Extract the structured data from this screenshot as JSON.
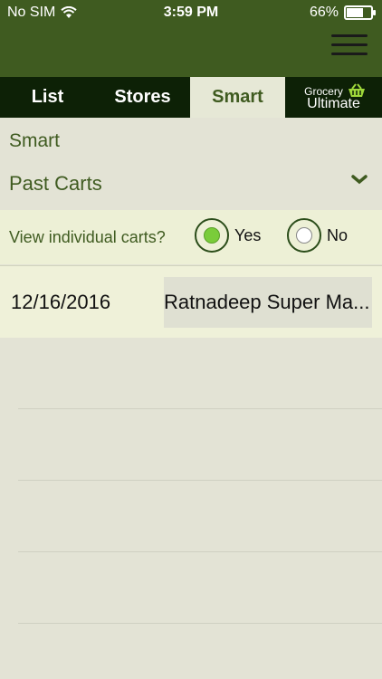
{
  "status_bar": {
    "carrier": "No SIM",
    "time": "3:59 PM",
    "battery": "66%",
    "battery_level": 0.66
  },
  "tabs": [
    {
      "label": "List",
      "active": false
    },
    {
      "label": "Stores",
      "active": false
    },
    {
      "label": "Smart",
      "active": true
    }
  ],
  "brand": {
    "small": "Grocery",
    "big": "Ultimate"
  },
  "section": {
    "title": "Smart",
    "subtitle": "Past Carts"
  },
  "view_carts": {
    "label": "View individual carts?",
    "options": [
      {
        "label": "Yes",
        "selected": true
      },
      {
        "label": "No",
        "selected": false
      }
    ]
  },
  "carts": [
    {
      "date": "12/16/2016",
      "store": "Ratnadeep Super Ma..."
    }
  ],
  "colors": {
    "header": "#3f5b20",
    "tab_bar": "#0d2106",
    "accent_text": "#3f5b20",
    "radio_selected": "#7acc3a"
  },
  "icons": {
    "wifi": "wifi-icon",
    "menu": "hamburger-menu-icon",
    "basket": "basket-icon",
    "chevron": "chevron-down-icon"
  }
}
